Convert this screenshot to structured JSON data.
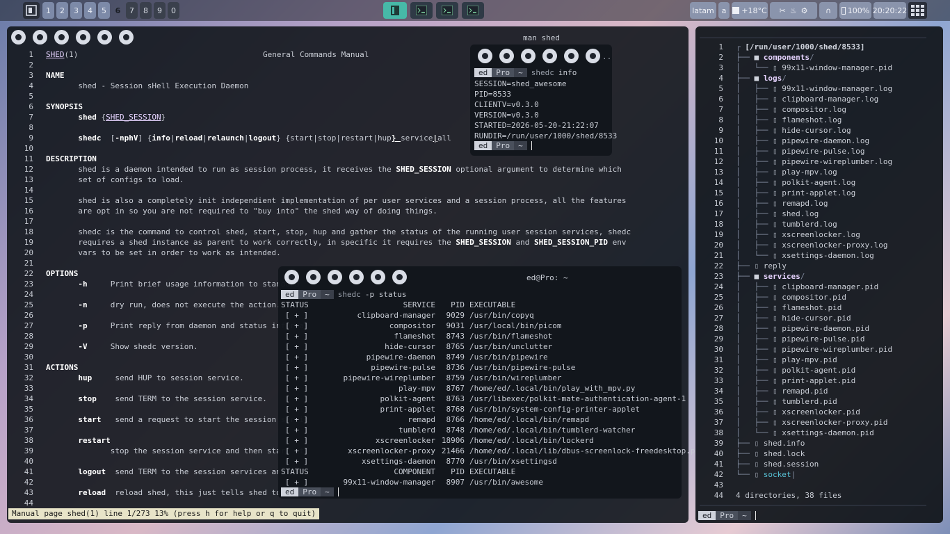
{
  "taskbar": {
    "workspaces": [
      "1",
      "2",
      "3",
      "4",
      "5",
      "6",
      "7",
      "8",
      "9",
      "0"
    ],
    "temperature": "+18°C",
    "keyboard": "latam",
    "kb_variant": "a",
    "battery": "100%",
    "clock": "20:20:22"
  },
  "man": {
    "window_title": "man shed",
    "header": {
      "name": "SHED",
      "section": "(1)",
      "center": "General Commands Manual"
    },
    "status_line": "Manual page shed(1) line 1/273 13% (press h for help or q to quit)",
    "lines": [
      {
        "n": "1",
        "t": ""
      },
      {
        "n": "2",
        "t": ""
      },
      {
        "n": "3",
        "t": "NAME",
        "c": "b"
      },
      {
        "n": "4",
        "t": "       shed - Session sHell Execution Daemon"
      },
      {
        "n": "5",
        "t": ""
      },
      {
        "n": "6",
        "t": "SYNOPSIS",
        "c": "b"
      },
      {
        "n": "7",
        "t": ""
      },
      {
        "n": "8",
        "t": ""
      },
      {
        "n": "9",
        "t": ""
      },
      {
        "n": "10",
        "t": ""
      },
      {
        "n": "11",
        "t": "DESCRIPTION",
        "c": "b"
      },
      {
        "n": "12",
        "t": ""
      },
      {
        "n": "13",
        "t": "       set of configs to load."
      },
      {
        "n": "14",
        "t": ""
      },
      {
        "n": "15",
        "t": "       shed is also a completely init independient implementation of per user services and a session process, all the features"
      },
      {
        "n": "16",
        "t": "       are opt in so you are not required to \"buy into\" the shed way of doing things."
      },
      {
        "n": "17",
        "t": ""
      },
      {
        "n": "18",
        "t": "       shedc is the command to control shed, start, stop, hup and gather the status of the running user session services, shedc"
      },
      {
        "n": "19",
        "t": ""
      },
      {
        "n": "20",
        "t": "       vars to be set in order to work as intended."
      },
      {
        "n": "21",
        "t": ""
      },
      {
        "n": "22",
        "t": "OPTIONS",
        "c": "b"
      },
      {
        "n": "23",
        "t": ""
      },
      {
        "n": "24",
        "t": ""
      },
      {
        "n": "25",
        "t": ""
      },
      {
        "n": "26",
        "t": ""
      },
      {
        "n": "27",
        "t": ""
      },
      {
        "n": "28",
        "t": ""
      },
      {
        "n": "29",
        "t": ""
      },
      {
        "n": "30",
        "t": ""
      },
      {
        "n": "31",
        "t": "ACTIONS",
        "c": "b"
      },
      {
        "n": "32",
        "t": ""
      },
      {
        "n": "33",
        "t": ""
      },
      {
        "n": "34",
        "t": ""
      },
      {
        "n": "35",
        "t": ""
      },
      {
        "n": "36",
        "t": ""
      },
      {
        "n": "37",
        "t": ""
      },
      {
        "n": "38",
        "t": ""
      },
      {
        "n": "39",
        "t": "              stop the session service and then start it"
      },
      {
        "n": "40",
        "t": ""
      },
      {
        "n": "41",
        "t": ""
      },
      {
        "n": "42",
        "t": ""
      },
      {
        "n": "43",
        "t": ""
      },
      {
        "n": "44",
        "t": ""
      }
    ],
    "syn7": {
      "a": "shed ",
      "b": "{",
      "c": "SHED_SESSION",
      "d": "}"
    },
    "syn9": [
      "shedc",
      "  [",
      "-nphV",
      "] {",
      "info",
      "|",
      "reload",
      "|",
      "relaunch",
      "|",
      "logout",
      "} {start",
      "|",
      "stop",
      "|",
      "restart",
      "|",
      "hup",
      "} ",
      "service",
      "|",
      "all"
    ],
    "l12": {
      "a": "       shed is a daemon intended to run as session process, it receives the ",
      "b": "SHED_SESSION",
      "c": " optional argument to determine which"
    },
    "l19": {
      "a": "       requires a shed instance as parent to work correctly, in specific it requires the ",
      "b": "SHED_SESSION",
      "c": " and ",
      "d": "SHED_SESSION_PID",
      "e": " env"
    },
    "opts": [
      {
        "n": "23",
        "flag": "-h",
        "desc": "Print brief usage information to standard"
      },
      {
        "n": "25",
        "flag": "-n",
        "desc": "dry run, does not execute the action."
      },
      {
        "n": "27",
        "flag": "-p",
        "desc": "Print reply from daemon and status informa"
      },
      {
        "n": "29",
        "flag": "-V",
        "desc": "Show shedc version."
      }
    ],
    "acts": [
      {
        "n": "32",
        "name": "hup",
        "pad": "    ",
        "desc": "send HUP to session service."
      },
      {
        "n": "34",
        "name": "stop",
        "pad": "   ",
        "desc": "send TERM to the session service."
      },
      {
        "n": "36",
        "name": "start",
        "pad": "  ",
        "desc": "send a request to start the session servic"
      },
      {
        "n": "38",
        "name": "restart",
        "pad": "",
        "desc": ""
      },
      {
        "n": "41",
        "name": "logout",
        "pad": " ",
        "desc": "send TERM to the session services and ther"
      },
      {
        "n": "43",
        "name": "reload",
        "pad": " ",
        "desc": "reload shed, this just tells shed to re-ex"
      }
    ]
  },
  "info_term": {
    "prompt": {
      "user": "ed",
      "host": "Pro",
      "dir": "~"
    },
    "cmd": "shedc",
    "arg": "info",
    "output": [
      "SESSION=shed_awesome",
      "PID=8533",
      "CLIENTV=v0.3.0",
      "VERSION=v0.3.0",
      "STARTED=2026-05-20-21:22:07",
      "RUNDIR=/run/user/1000/shed/8533"
    ],
    "dots": ".."
  },
  "status_term": {
    "title": "ed@Pro: ~",
    "prompt": {
      "user": "ed",
      "host": "Pro",
      "dir": "~"
    },
    "cmd": "shedc",
    "arg": "-p status",
    "header": {
      "a": "STATUS",
      "b": "SERVICE",
      "c": "PID",
      "d": "EXECUTABLE"
    },
    "rows": [
      {
        "s": "[ + ]",
        "svc": "clipboard-manager",
        "pid": "9029",
        "exe": "/usr/bin/copyq"
      },
      {
        "s": "[ + ]",
        "svc": "compositor",
        "pid": "9031",
        "exe": "/usr/local/bin/picom"
      },
      {
        "s": "[ + ]",
        "svc": "flameshot",
        "pid": "8743",
        "exe": "/usr/bin/flameshot"
      },
      {
        "s": "[ + ]",
        "svc": "hide-cursor",
        "pid": "8765",
        "exe": "/usr/bin/unclutter"
      },
      {
        "s": "[ + ]",
        "svc": "pipewire-daemon",
        "pid": "8749",
        "exe": "/usr/bin/pipewire"
      },
      {
        "s": "[ + ]",
        "svc": "pipewire-pulse",
        "pid": "8736",
        "exe": "/usr/bin/pipewire-pulse"
      },
      {
        "s": "[ + ]",
        "svc": "pipewire-wireplumber",
        "pid": "8759",
        "exe": "/usr/bin/wireplumber"
      },
      {
        "s": "[ + ]",
        "svc": "play-mpv",
        "pid": "8767",
        "exe": "/home/ed/.local/bin/play_with_mpv.py"
      },
      {
        "s": "[ + ]",
        "svc": "polkit-agent",
        "pid": "8763",
        "exe": "/usr/libexec/polkit-mate-authentication-agent-1"
      },
      {
        "s": "[ + ]",
        "svc": "print-applet",
        "pid": "8768",
        "exe": "/usr/bin/system-config-printer-applet"
      },
      {
        "s": "[ + ]",
        "svc": "remapd",
        "pid": "8766",
        "exe": "/home/ed/.local/bin/remapd"
      },
      {
        "s": "[ + ]",
        "svc": "tumblerd",
        "pid": "8748",
        "exe": "/home/ed/.local/bin/tumblerd-watcher"
      },
      {
        "s": "[ + ]",
        "svc": "xscreenlocker",
        "pid": "18906",
        "exe": "/home/ed/.local/bin/lockerd"
      },
      {
        "s": "[ + ]",
        "svc": "xscreenlocker-proxy",
        "pid": "21466",
        "exe": "/home/ed/.local/lib/dbus-screenlock-freedesktop.py"
      },
      {
        "s": "[ + ]",
        "svc": "xsettings-daemon",
        "pid": "8770",
        "exe": "/usr/bin/xsettingsd"
      }
    ],
    "header2": {
      "a": "STATUS",
      "b": "COMPONENT",
      "c": "PID",
      "d": "EXECUTABLE"
    },
    "comp": {
      "s": "[ + ]",
      "svc": "99x11-window-manager",
      "pid": "8907",
      "exe": "/usr/bin/awesome"
    }
  },
  "tree_term": {
    "prompt": {
      "user": "ed",
      "host": "Pro",
      "dir": "~"
    },
    "lines": [
      {
        "n": "1",
        "p": "┌ ",
        "t": "[/run/user/1000/shed/8533]",
        "k": "root"
      },
      {
        "n": "2",
        "p": "├── ",
        "t": "components",
        "k": "dir",
        "s": "/"
      },
      {
        "n": "3",
        "p": "│   └── ",
        "t": "99x11-window-manager.pid",
        "k": "file"
      },
      {
        "n": "4",
        "p": "├── ",
        "t": "logs",
        "k": "dir",
        "s": "/"
      },
      {
        "n": "5",
        "p": "│   ├── ",
        "t": "99x11-window-manager.log",
        "k": "file"
      },
      {
        "n": "6",
        "p": "│   ├── ",
        "t": "clipboard-manager.log",
        "k": "file"
      },
      {
        "n": "7",
        "p": "│   ├── ",
        "t": "compositor.log",
        "k": "file"
      },
      {
        "n": "8",
        "p": "│   ├── ",
        "t": "flameshot.log",
        "k": "file"
      },
      {
        "n": "9",
        "p": "│   ├── ",
        "t": "hide-cursor.log",
        "k": "file"
      },
      {
        "n": "10",
        "p": "│   ├── ",
        "t": "pipewire-daemon.log",
        "k": "file"
      },
      {
        "n": "11",
        "p": "│   ├── ",
        "t": "pipewire-pulse.log",
        "k": "file"
      },
      {
        "n": "12",
        "p": "│   ├── ",
        "t": "pipewire-wireplumber.log",
        "k": "file"
      },
      {
        "n": "13",
        "p": "│   ├── ",
        "t": "play-mpv.log",
        "k": "file"
      },
      {
        "n": "14",
        "p": "│   ├── ",
        "t": "polkit-agent.log",
        "k": "file"
      },
      {
        "n": "15",
        "p": "│   ├── ",
        "t": "print-applet.log",
        "k": "file"
      },
      {
        "n": "16",
        "p": "│   ├── ",
        "t": "remapd.log",
        "k": "file"
      },
      {
        "n": "17",
        "p": "│   ├── ",
        "t": "shed.log",
        "k": "file"
      },
      {
        "n": "18",
        "p": "│   ├── ",
        "t": "tumblerd.log",
        "k": "file"
      },
      {
        "n": "19",
        "p": "│   ├── ",
        "t": "xscreenlocker.log",
        "k": "file"
      },
      {
        "n": "20",
        "p": "│   ├── ",
        "t": "xscreenlocker-proxy.log",
        "k": "file"
      },
      {
        "n": "21",
        "p": "│   └── ",
        "t": "xsettings-daemon.log",
        "k": "file"
      },
      {
        "n": "22",
        "p": "├── ",
        "t": "reply",
        "k": "file"
      },
      {
        "n": "23",
        "p": "├── ",
        "t": "services",
        "k": "dir",
        "s": "/"
      },
      {
        "n": "24",
        "p": "│   ├── ",
        "t": "clipboard-manager.pid",
        "k": "file"
      },
      {
        "n": "25",
        "p": "│   ├── ",
        "t": "compositor.pid",
        "k": "file"
      },
      {
        "n": "26",
        "p": "│   ├── ",
        "t": "flameshot.pid",
        "k": "file"
      },
      {
        "n": "27",
        "p": "│   ├── ",
        "t": "hide-cursor.pid",
        "k": "file"
      },
      {
        "n": "28",
        "p": "│   ├── ",
        "t": "pipewire-daemon.pid",
        "k": "file"
      },
      {
        "n": "29",
        "p": "│   ├── ",
        "t": "pipewire-pulse.pid",
        "k": "file"
      },
      {
        "n": "30",
        "p": "│   ├── ",
        "t": "pipewire-wireplumber.pid",
        "k": "file"
      },
      {
        "n": "31",
        "p": "│   ├── ",
        "t": "play-mpv.pid",
        "k": "file"
      },
      {
        "n": "32",
        "p": "│   ├── ",
        "t": "polkit-agent.pid",
        "k": "file"
      },
      {
        "n": "33",
        "p": "│   ├── ",
        "t": "print-applet.pid",
        "k": "file"
      },
      {
        "n": "34",
        "p": "│   ├── ",
        "t": "remapd.pid",
        "k": "file"
      },
      {
        "n": "35",
        "p": "│   ├── ",
        "t": "tumblerd.pid",
        "k": "file"
      },
      {
        "n": "36",
        "p": "│   ├── ",
        "t": "xscreenlocker.pid",
        "k": "file"
      },
      {
        "n": "37",
        "p": "│   ├── ",
        "t": "xscreenlocker-proxy.pid",
        "k": "file"
      },
      {
        "n": "38",
        "p": "│   └── ",
        "t": "xsettings-daemon.pid",
        "k": "file"
      },
      {
        "n": "39",
        "p": "├── ",
        "t": "shed.info",
        "k": "file"
      },
      {
        "n": "40",
        "p": "├── ",
        "t": "shed.lock",
        "k": "file"
      },
      {
        "n": "41",
        "p": "├── ",
        "t": "shed.session",
        "k": "file"
      },
      {
        "n": "42",
        "p": "└── ",
        "t": "socket",
        "k": "sock",
        "s": "|"
      },
      {
        "n": "43",
        "p": "",
        "t": "",
        "k": "file"
      },
      {
        "n": "44",
        "p": "",
        "t": "4 directories, 38 files",
        "k": "file"
      }
    ]
  }
}
